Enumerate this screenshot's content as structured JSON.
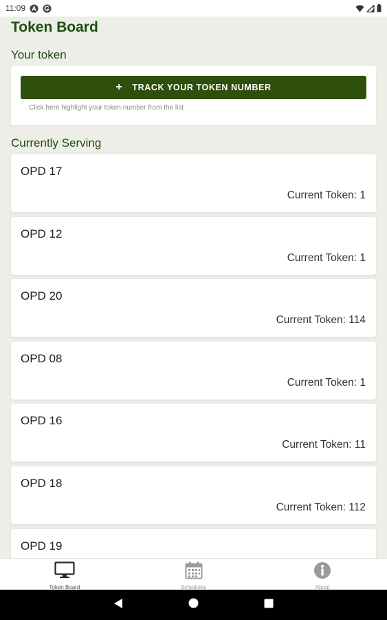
{
  "status_bar": {
    "time": "11:09"
  },
  "page_title": "Token Board",
  "your_token": {
    "section_label": "Your token",
    "track_button_label": "TRACK YOUR TOKEN NUMBER",
    "hint": "Click here highlight your token number from the list"
  },
  "serving": {
    "section_label": "Currently Serving",
    "items": [
      {
        "name": "OPD 17",
        "current": "Current Token: 1"
      },
      {
        "name": "OPD 12",
        "current": "Current Token: 1"
      },
      {
        "name": "OPD 20",
        "current": "Current Token: 114"
      },
      {
        "name": "OPD 08",
        "current": "Current Token: 1"
      },
      {
        "name": "OPD 16",
        "current": "Current Token: 11"
      },
      {
        "name": "OPD 18",
        "current": "Current Token: 112"
      },
      {
        "name": "OPD 19",
        "current": ""
      }
    ]
  },
  "bottom_nav": [
    {
      "label": "Token Board",
      "icon": "monitor-icon",
      "active": true
    },
    {
      "label": "Schedules",
      "icon": "calendar-icon",
      "active": false
    },
    {
      "label": "About",
      "icon": "info-icon",
      "active": false
    }
  ],
  "colors": {
    "primary": "#2f4f0c",
    "heading": "#1e4d0e",
    "background": "#eceee7"
  }
}
